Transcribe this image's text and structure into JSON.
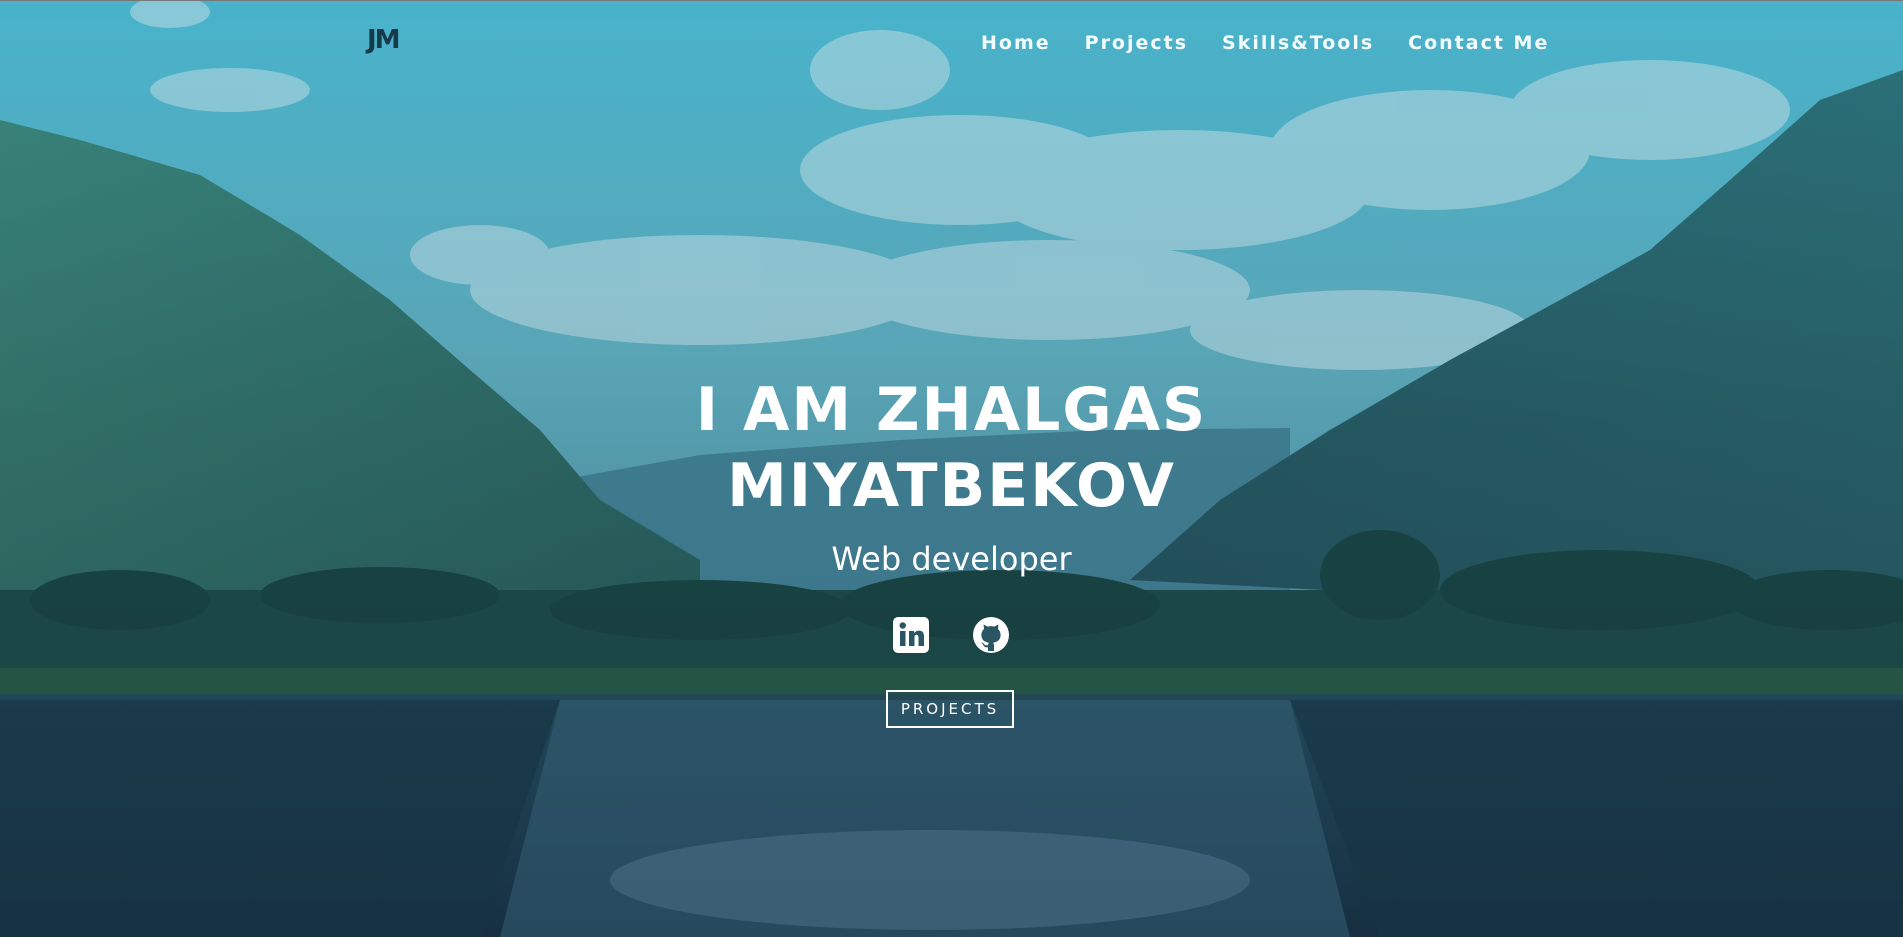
{
  "logo": {
    "text": "JM"
  },
  "nav": {
    "items": [
      {
        "label": "Home"
      },
      {
        "label": "Projects"
      },
      {
        "label": "Skills&Tools"
      },
      {
        "label": "Contact Me"
      }
    ]
  },
  "hero": {
    "title_line1": "I AM ZHALGAS",
    "title_line2": "MIYATBEKOV",
    "subtitle": "Web developer",
    "cta_label": "PROJECTS",
    "social_icons": [
      "linkedin-icon",
      "github-icon"
    ]
  },
  "colors": {
    "sky": "#5cc0d6",
    "mountain": "#2f6a66",
    "water": "#1f3e4e",
    "text": "#ffffff",
    "logo": "#163a4a"
  }
}
